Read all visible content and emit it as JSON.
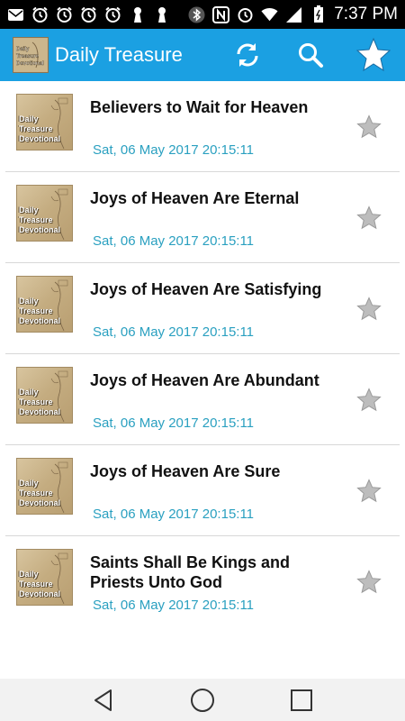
{
  "status": {
    "time": "7:37 PM"
  },
  "app": {
    "title": "Daily Treasure",
    "logo_text": "Daily Treasure Devotional",
    "accent_color": "#1ba0e2"
  },
  "items": [
    {
      "title": "Believers to Wait for Heaven",
      "date": "Sat, 06 May 2017 20:15:11",
      "thumb_text": "Daily Treasure Devotional"
    },
    {
      "title": "Joys of Heaven Are Eternal",
      "date": "Sat, 06 May 2017 20:15:11",
      "thumb_text": "Daily Treasure Devotional"
    },
    {
      "title": "Joys of Heaven Are Satisfying",
      "date": "Sat, 06 May 2017 20:15:11",
      "thumb_text": "Daily Treasure Devotional"
    },
    {
      "title": "Joys of Heaven Are Abundant",
      "date": "Sat, 06 May 2017 20:15:11",
      "thumb_text": "Daily Treasure Devotional"
    },
    {
      "title": "Joys of Heaven Are Sure",
      "date": "Sat, 06 May 2017 20:15:11",
      "thumb_text": "Daily Treasure Devotional"
    },
    {
      "title": "Saints Shall Be Kings and Priests Unto God",
      "date": "Sat, 06 May 2017 20:15:11",
      "thumb_text": "Daily Treasure Devotional"
    }
  ],
  "icons": {
    "refresh": "refresh-icon",
    "search": "search-icon",
    "favorites": "star-icon",
    "nav_back": "back-triangle-icon",
    "nav_home": "home-circle-icon",
    "nav_recents": "recents-square-icon"
  }
}
